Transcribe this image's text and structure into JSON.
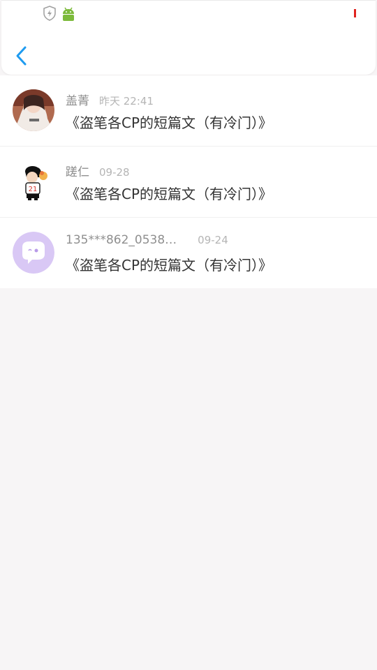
{
  "header": {
    "back_icon": "chevron-left-icon",
    "accent_color": "#1e9bf0"
  },
  "status_bar": {
    "left_icons": [
      "shield-bolt-icon",
      "android-icon"
    ],
    "right_indicator_color": "#e0231f"
  },
  "comments": [
    {
      "name": "盖菁",
      "time": "昨天 22:41",
      "content": "《盗笔各CP的短篇文（有冷门）》",
      "avatar": "photo-avatar"
    },
    {
      "name": "蹉仁",
      "time": "09-28",
      "content": "《盗笔各CP的短篇文（有冷门）》",
      "avatar": "cartoon-avatar"
    },
    {
      "name": "135***862_0538…",
      "time": "09-24",
      "content": "《盗笔各CP的短篇文（有冷门）》",
      "avatar": "default-chat-avatar"
    }
  ]
}
